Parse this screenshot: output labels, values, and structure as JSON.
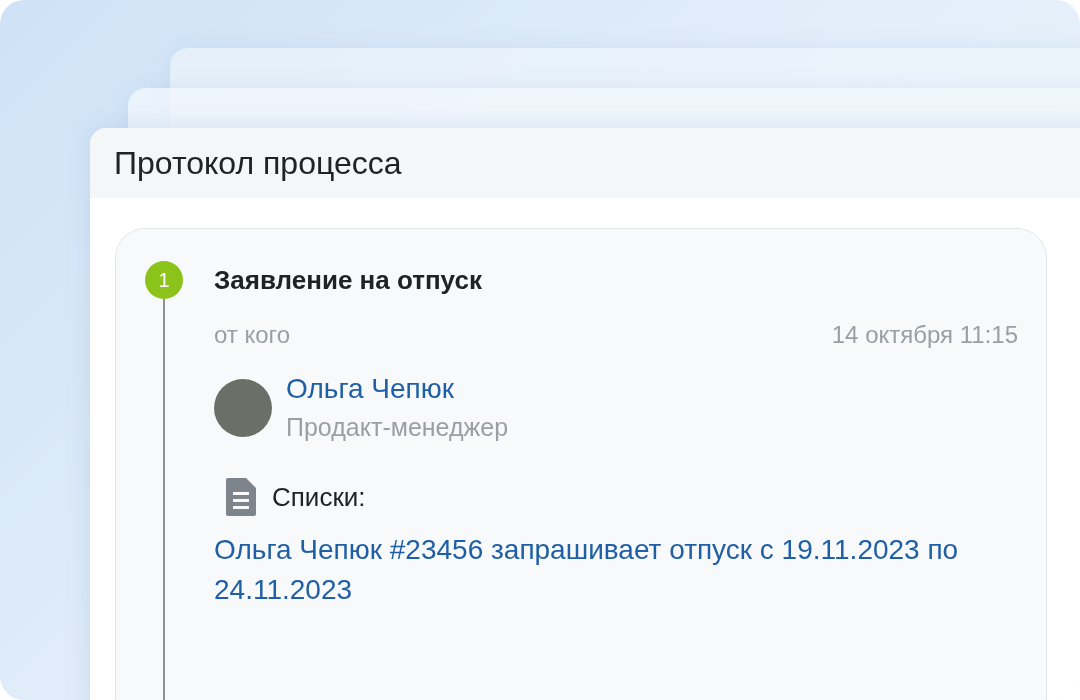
{
  "panel": {
    "title": "Протокол процесса"
  },
  "steps": [
    {
      "number": "1",
      "title": "Заявление на отпуск",
      "from_label": "от кого",
      "date": "14 октября 11:15",
      "author": {
        "name": "Ольга Чепюк",
        "role": "Продакт-менеджер"
      },
      "attachment_label": "Списки:",
      "description": "Ольга Чепюк #23456 запрашивает отпуск с 19.11.2023 по 24.11.2023"
    }
  ]
}
